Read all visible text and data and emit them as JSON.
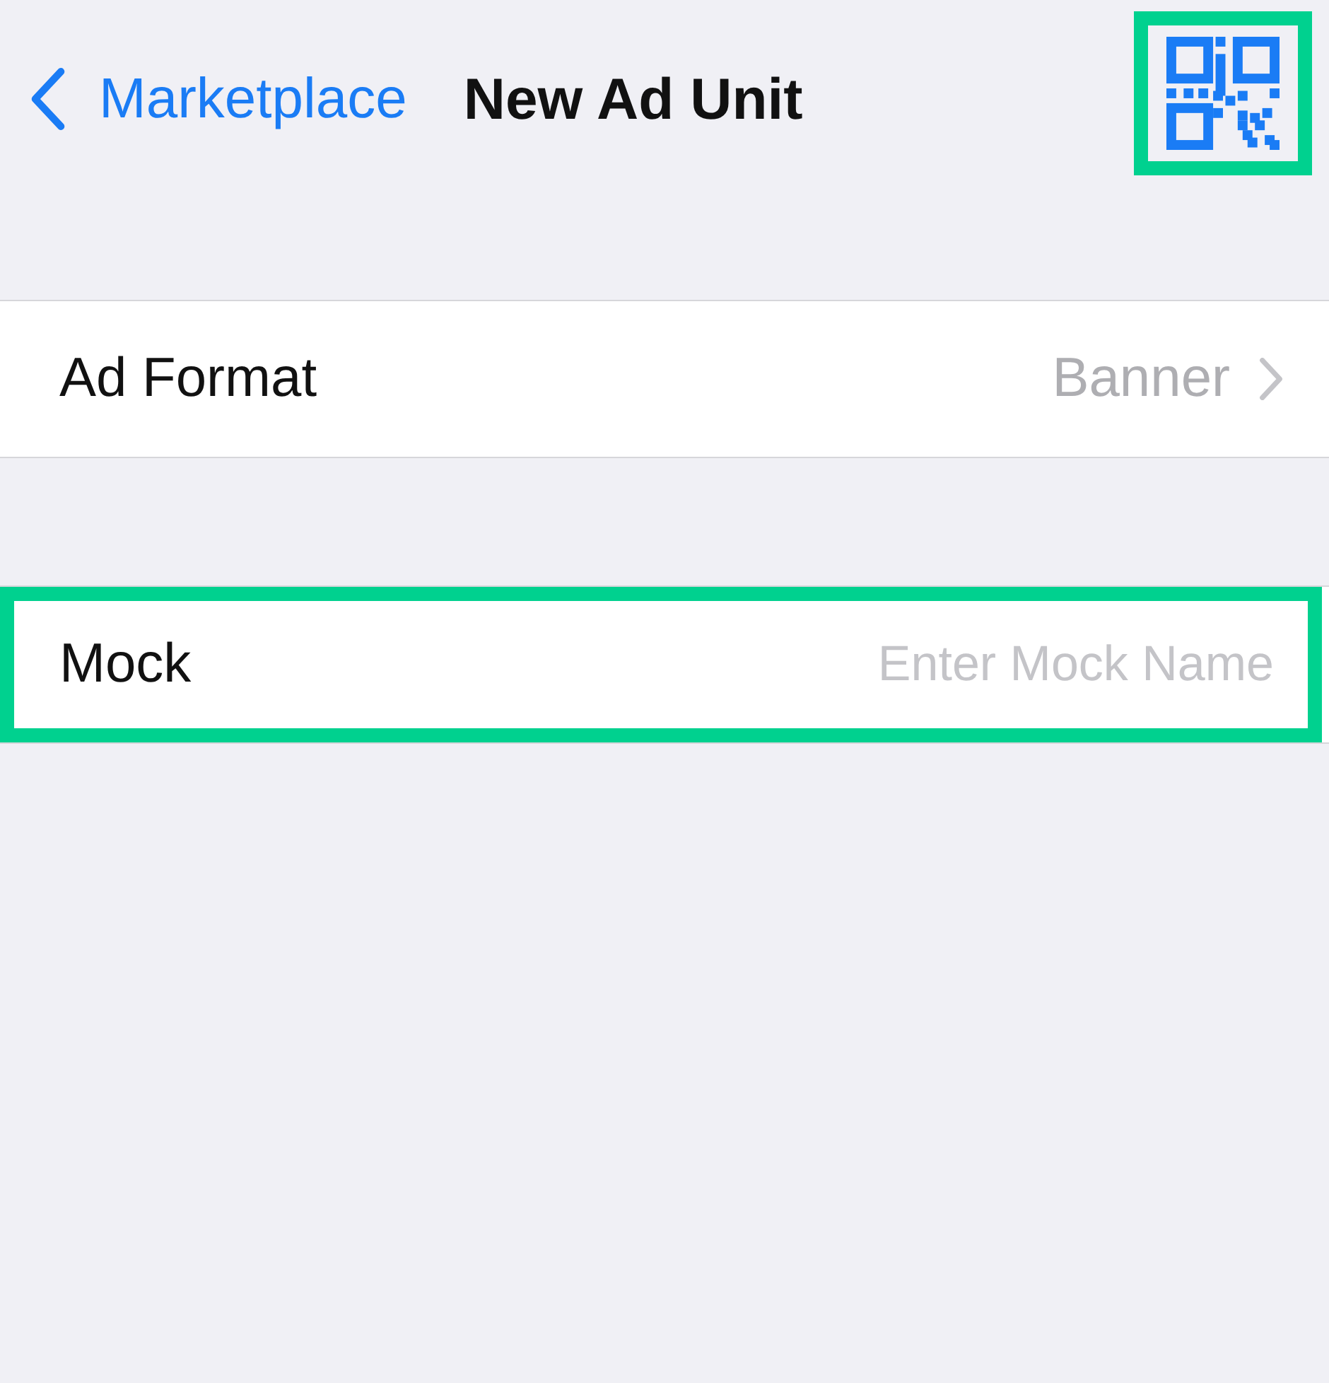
{
  "nav": {
    "back_label": "Marketplace",
    "title": "New Ad Unit",
    "qr_highlighted": true
  },
  "rows": [
    {
      "kind": "disclosure",
      "label": "Ad Format",
      "value": "Banner",
      "highlighted": false
    },
    {
      "kind": "field",
      "label": "Mock",
      "placeholder": "Enter Mock Name",
      "highlighted": true
    }
  ]
}
